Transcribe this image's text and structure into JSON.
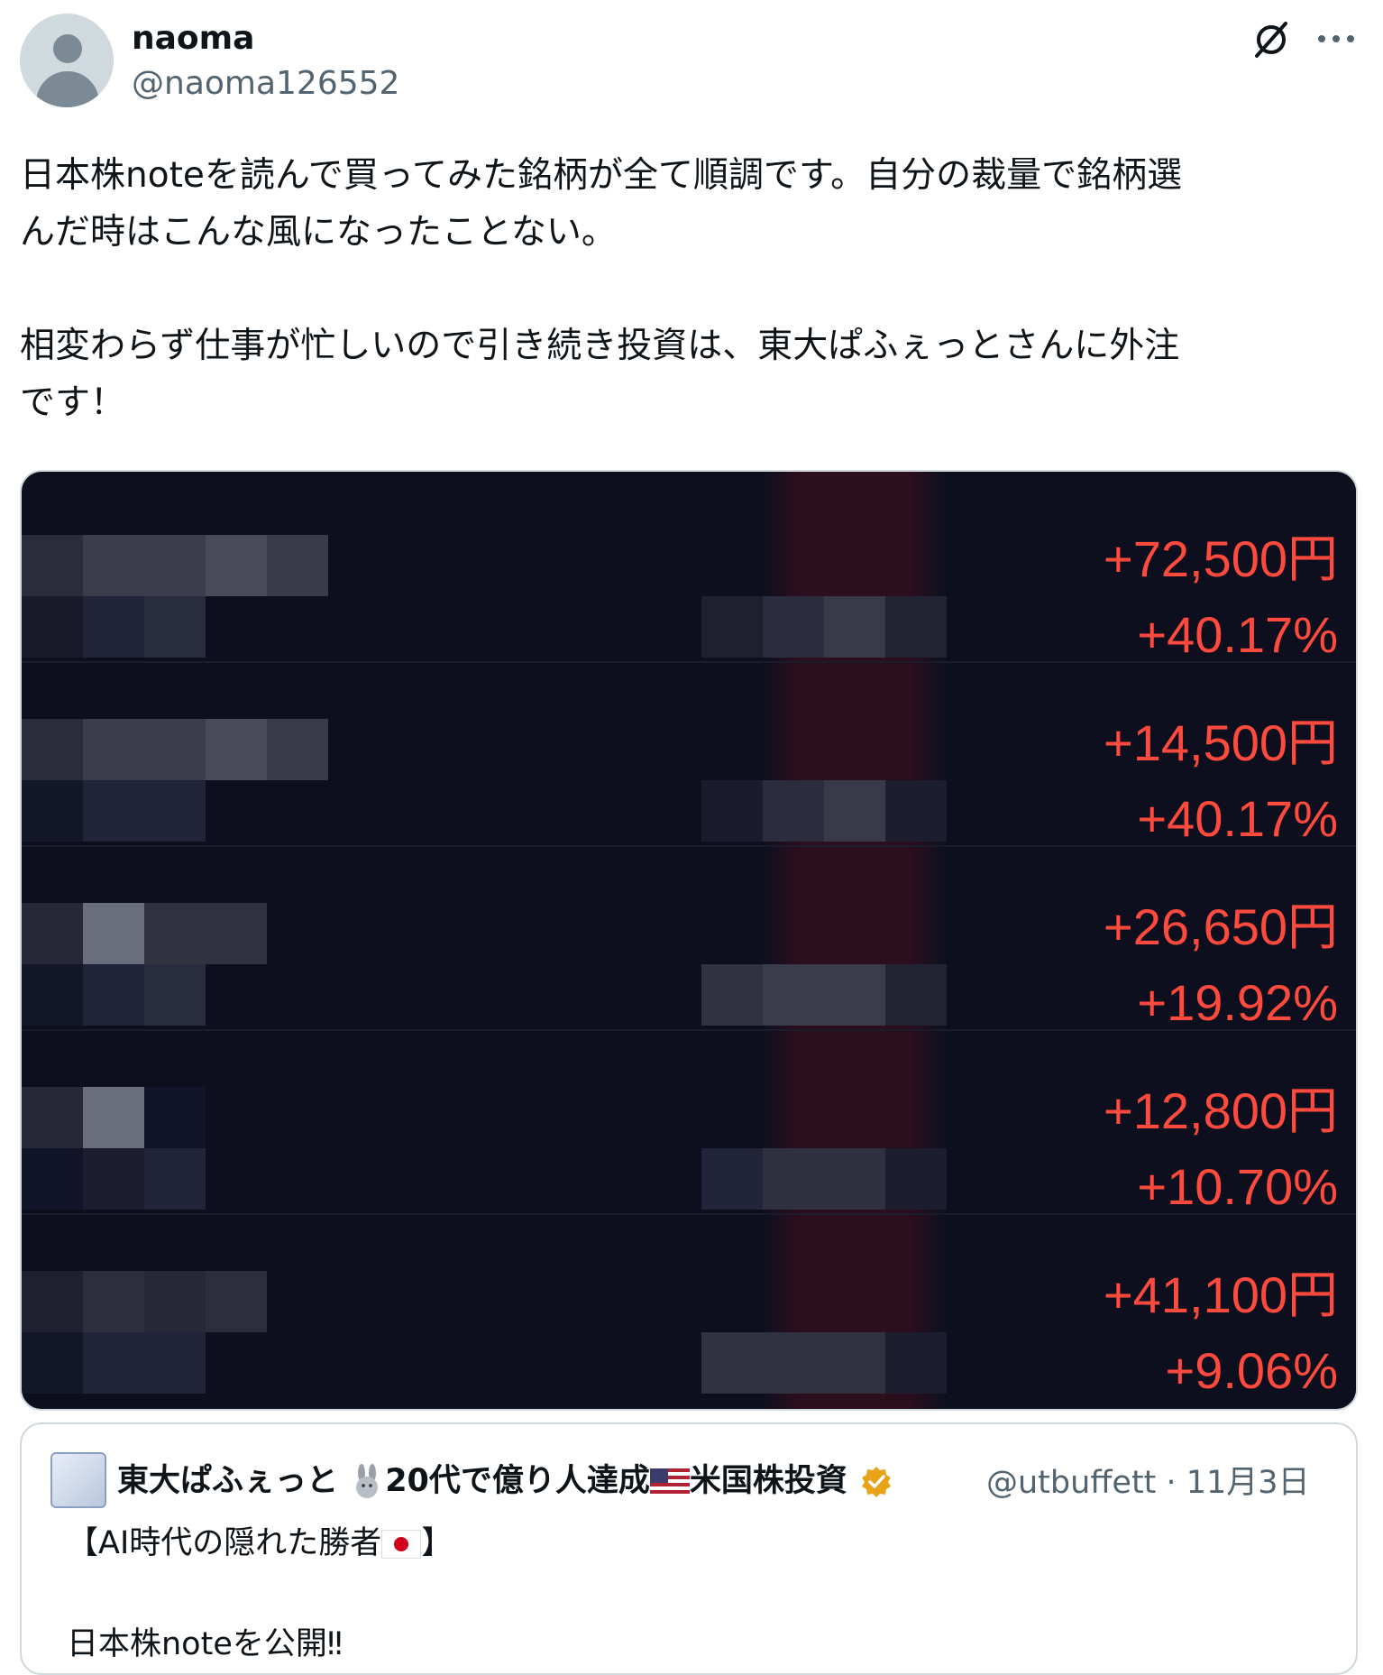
{
  "author": {
    "display_name": "naoma",
    "handle": "@naoma126552"
  },
  "post": {
    "lines": [
      "日本株noteを読んで買ってみた銘柄が全て順調です。自分の裁量で銘柄選",
      "んだ時はこんな風になったことない。",
      "",
      "相変わらず仕事が忙しいので引き続き投資は、東大ぱふぇっとさんに外注",
      "です！"
    ]
  },
  "holdings": [
    {
      "gain_amount": "+72,500円",
      "gain_percent": "+40.17%"
    },
    {
      "gain_amount": "+14,500円",
      "gain_percent": "+40.17%"
    },
    {
      "gain_amount": "+26,650円",
      "gain_percent": "+19.92%"
    },
    {
      "gain_amount": "+12,800円",
      "gain_percent": "+10.70%"
    },
    {
      "gain_amount": "+41,100円",
      "gain_percent": "+9.06%"
    }
  ],
  "quoted_post": {
    "name_part1": "東大ぱふぇっと",
    "name_part2": "20代で億り人達成",
    "name_part3": "米国株投資",
    "handle_date": "@utbuffett · 11月3日",
    "line1_a": "【AI時代の隠れた勝者",
    "line1_b": "】",
    "line2": "日本株noteを公開‼"
  },
  "colors": {
    "gain_red": "#ff4a3d",
    "panel_bg": "#0d0f1e",
    "muted": "#536471"
  },
  "icons": [
    "grok-icon",
    "more-icon",
    "verified-badge-icon",
    "rabbit-icon",
    "us-flag-icon",
    "jp-flag-icon"
  ]
}
